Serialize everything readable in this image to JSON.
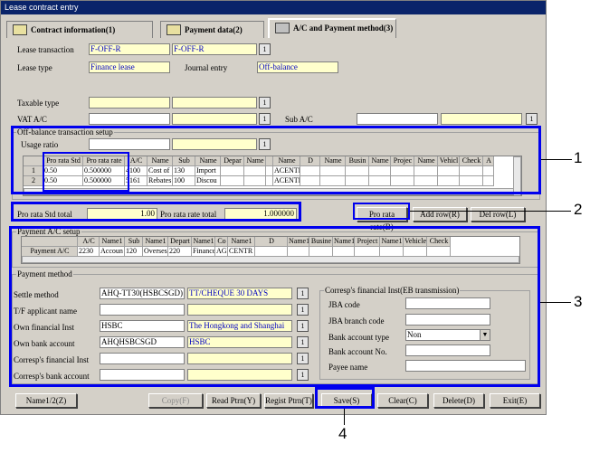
{
  "window": {
    "title": "Lease contract entry"
  },
  "tabs": [
    {
      "label": "Contract information(1)"
    },
    {
      "label": "Payment data(2)"
    },
    {
      "label": "A/C and Payment method(3)"
    }
  ],
  "header": {
    "lease_transaction_label": "Lease transaction",
    "lease_transaction_code": "F-OFF-R",
    "lease_transaction_name": "F-OFF-R",
    "lease_type_label": "Lease type",
    "lease_type_value": "Finance lease",
    "journal_entry_label": "Journal entry",
    "journal_entry_value": "Off-balance",
    "taxable_type_label": "Taxable type",
    "vat_ac_label": "VAT A/C",
    "sub_ac_label": "Sub A/C"
  },
  "offbalance": {
    "group_label": "Off-balance transaction setup",
    "usage_ratio_label": "Usage ratio",
    "columns": [
      "",
      "Pro rata Std",
      "Pro rata rate",
      "A/C",
      "Name",
      "Sub",
      "Name",
      "Depar",
      "Name",
      "",
      "Name",
      "D",
      "Name",
      "Busin",
      "Name",
      "Projec",
      "Name",
      "Vehicl",
      "Check",
      "A"
    ],
    "rows": [
      [
        "1",
        "0.50",
        "0.500000",
        "4100",
        "Cost of",
        "130",
        "Import",
        "",
        "",
        "",
        "ACENTR",
        "",
        "",
        "",
        "",
        "",
        "",
        "",
        "",
        ""
      ],
      [
        "2",
        "0.50",
        "0.500000",
        "5161",
        "Rebates",
        "100",
        "Discou",
        "",
        "",
        "",
        "ACENTR",
        "",
        "",
        "",
        "",
        "",
        "",
        "",
        "",
        ""
      ]
    ],
    "pro_rata_std_total_label": "Pro rata Std total",
    "pro_rata_std_total": "1.00",
    "pro_rata_rate_total_label": "Pro rata rate total",
    "pro_rata_rate_total": "1.000000",
    "pro_rata_rate_button": "Pro rata rate(B)",
    "add_row_button": "Add row(R)",
    "delete_row_button": "Del row(L)"
  },
  "payment_ac": {
    "group_label": "Payment A/C setup",
    "columns": [
      "",
      "A/C",
      "Name1",
      "Sub",
      "Name1",
      "Depart",
      "Name1",
      "Co",
      "Name1",
      "D",
      "Name1",
      "Busine",
      "Name1",
      "Project",
      "Name1",
      "Vehicle",
      "Check"
    ],
    "row": [
      "Payment A/C",
      "2230",
      "Accoun",
      "120",
      "Overses",
      "220",
      "Finance",
      "AGI",
      "CENTR",
      "",
      "",
      "",
      "",
      "",
      "",
      "",
      ""
    ]
  },
  "payment_method": {
    "group_label": "Payment method",
    "settle_method_label": "Settle method",
    "settle_method_code": "AHQ-TT30(HSBCSGD)",
    "settle_method_name": "TT/CHEQUE 30 DAYS",
    "tf_applicant_label": "T/F applicant name",
    "own_fin_inst_label": "Own financial Inst",
    "own_fin_inst_code": "HSBC",
    "own_fin_inst_name": "The Hongkong and Shanghai",
    "own_bank_account_label": "Own bank account",
    "own_bank_account_code": "AHQHSBCSGD",
    "own_bank_account_name": "HSBC",
    "corresp_fin_inst_label": "Corresp's financial Inst",
    "corresp_bank_account_label": "Corresp's bank account"
  },
  "eb": {
    "group_label": "Corresp's financial Inst(EB transmission)",
    "jba_code_label": "JBA code",
    "jba_branch_code_label": "JBA branch code",
    "bank_account_type_label": "Bank account type",
    "bank_account_type_value": "Non",
    "bank_account_no_label": "Bank account No.",
    "payee_name_label": "Payee name"
  },
  "footer": {
    "name1_button": "Name1/2(Z)",
    "copy_button": "Copy(F)",
    "read_ptrn_button": "Read Ptrn(Y)",
    "regist_ptrn_button": "Regist Ptrn(T)",
    "save_button": "Save(S)",
    "clear_button": "Clear(C)",
    "delete_button": "Delete(D)",
    "exit_button": "Exit(E)"
  },
  "callouts": [
    "1",
    "2",
    "3",
    "4"
  ],
  "colors": {
    "callout_frame": "#0000ee",
    "input_yellow": "#ffffcc",
    "title_bar": "#0a246a"
  }
}
